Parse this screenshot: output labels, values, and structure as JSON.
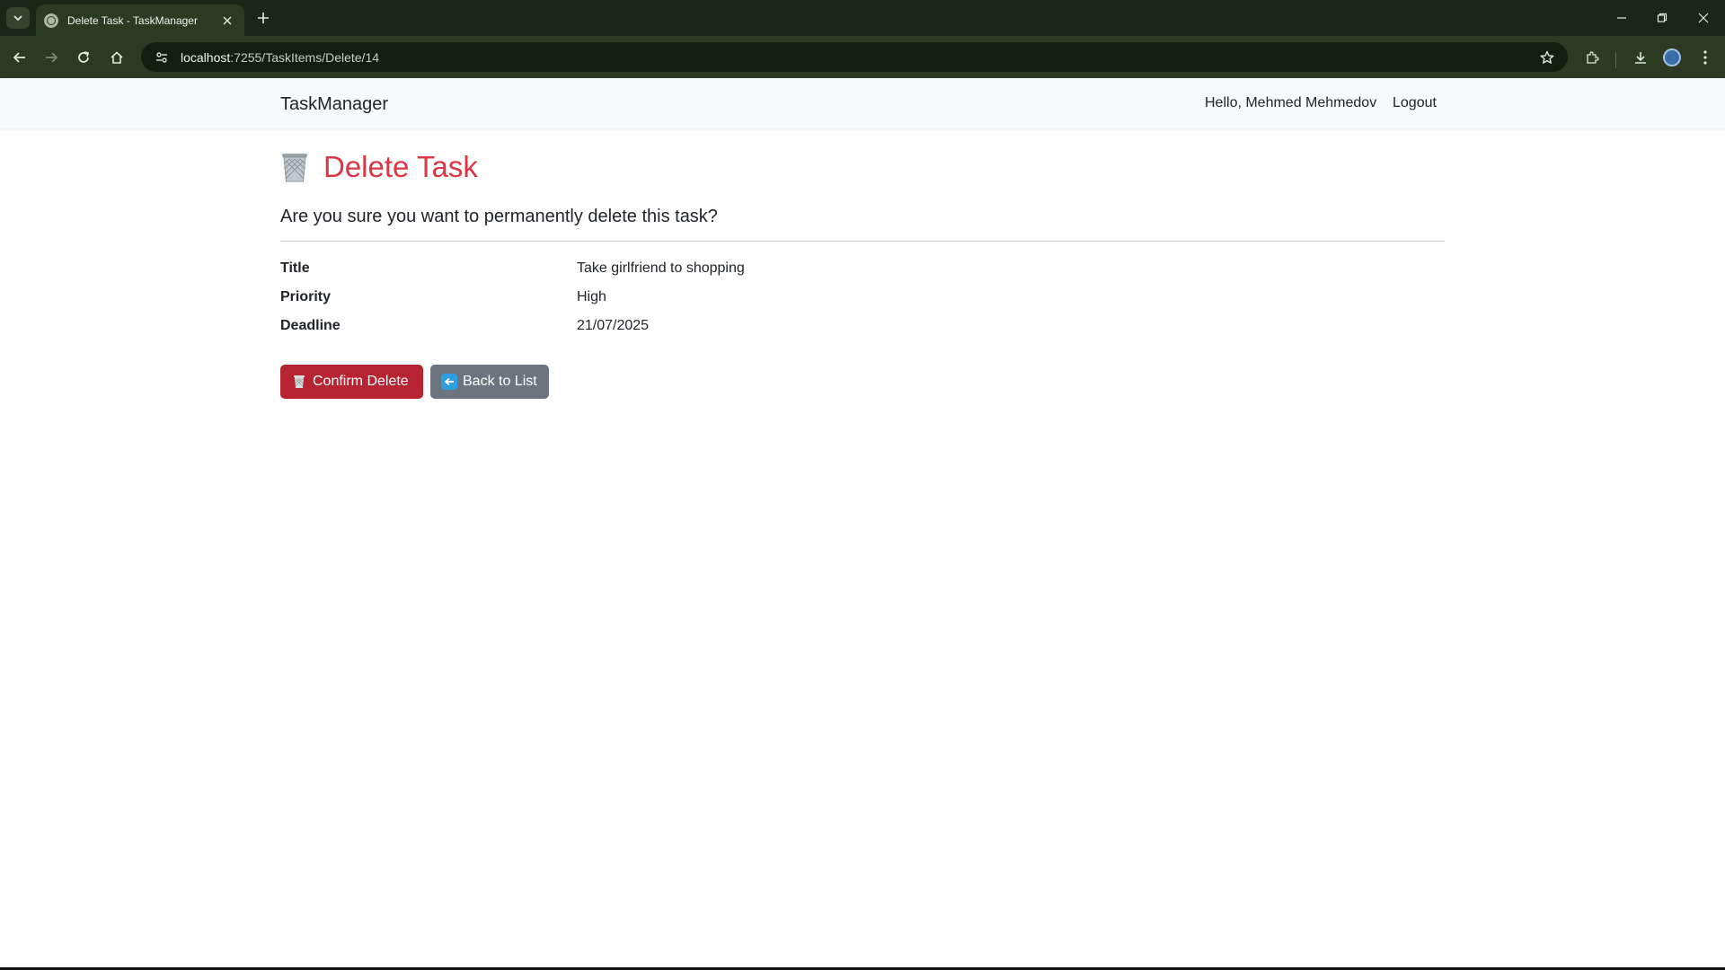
{
  "browser": {
    "tab_title": "Delete Task - TaskManager",
    "url_host": "localhost",
    "url_rest": ":7255/TaskItems/Delete/14",
    "icons": {
      "tab_search": "chevron-down-icon",
      "favicon": "globe-icon",
      "tab_close": "close-icon",
      "new_tab": "plus-icon",
      "back": "back-arrow-icon",
      "forward": "forward-arrow-icon",
      "reload": "reload-icon",
      "home": "home-icon",
      "site_info": "site-settings-icon",
      "bookmark": "star-icon",
      "extensions": "puzzle-icon",
      "downloads": "download-icon",
      "profile": "profile-avatar-icon",
      "menu": "kebab-menu-icon",
      "minimize": "minimize-icon",
      "restore": "restore-icon",
      "close_window": "close-window-icon"
    }
  },
  "navbar": {
    "brand": "TaskManager",
    "greeting": "Hello, Mehmed Mehmedov",
    "logout": "Logout",
    "background": "#f8f9fa"
  },
  "page": {
    "heading": "Delete Task",
    "heading_color": "#dc3545",
    "heading_icon": "wastebasket-icon",
    "question": "Are you sure you want to permanently delete this task?",
    "details": [
      {
        "label": "Title",
        "value": "Take girlfriend to shopping"
      },
      {
        "label": "Priority",
        "value": "High"
      },
      {
        "label": "Deadline",
        "value": "21/07/2025"
      }
    ],
    "buttons": {
      "confirm": {
        "label": "Confirm Delete",
        "icon": "wastebasket-icon",
        "color": "#b62432"
      },
      "back": {
        "label": "Back to List",
        "icon": "left-arrow-icon",
        "color": "#6c757d"
      }
    }
  }
}
